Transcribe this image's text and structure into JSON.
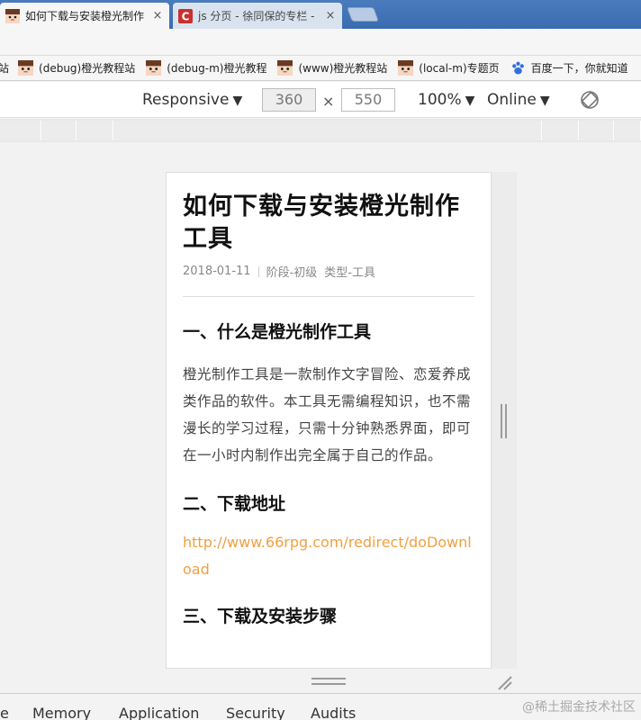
{
  "browser": {
    "tabs": [
      {
        "title": "如何下载与安装橙光制作",
        "close": "×",
        "active": true
      },
      {
        "title": "js 分页 - 徐同保的专栏 -",
        "close": "×",
        "active": false
      }
    ],
    "bookmarks": [
      {
        "label": "站",
        "icon": "avatar-icon"
      },
      {
        "label": "(debug)橙光教程站",
        "icon": "avatar-icon"
      },
      {
        "label": "(debug-m)橙光教程",
        "icon": "avatar-icon"
      },
      {
        "label": "(www)橙光教程站",
        "icon": "avatar-icon"
      },
      {
        "label": "(local-m)专题页",
        "icon": "avatar-icon"
      },
      {
        "label": "百度一下，你就知道",
        "icon": "baidu-paw-icon"
      }
    ]
  },
  "device_toolbar": {
    "device": "Responsive",
    "width": "360",
    "height": "550",
    "times": "×",
    "zoom": "100%",
    "network": "Online",
    "caret": "▼"
  },
  "article": {
    "title": "如何下载与安装橙光制作工具",
    "date": "2018-01-11",
    "tags": [
      "阶段-初级",
      "类型-工具"
    ],
    "section1_heading": "一、什么是橙光制作工具",
    "section1_body": "橙光制作工具是一款制作文字冒险、恋爱养成类作品的软件。本工具无需编程知识，也不需漫长的学习过程，只需十分钟熟悉界面，即可在一小时内制作出完全属于自己的作品。",
    "section2_heading": "二、下载地址",
    "download_link": "http://www.66rpg.com/redirect/doDownload",
    "section3_heading": "三、下载及安装步骤"
  },
  "devtools_tabs": [
    "e",
    "Memory",
    "Application",
    "Security",
    "Audits"
  ],
  "watermark": "@稀土掘金技术社区",
  "colors": {
    "link": "#f0a040",
    "tabstrip": "#3a6cb0"
  }
}
